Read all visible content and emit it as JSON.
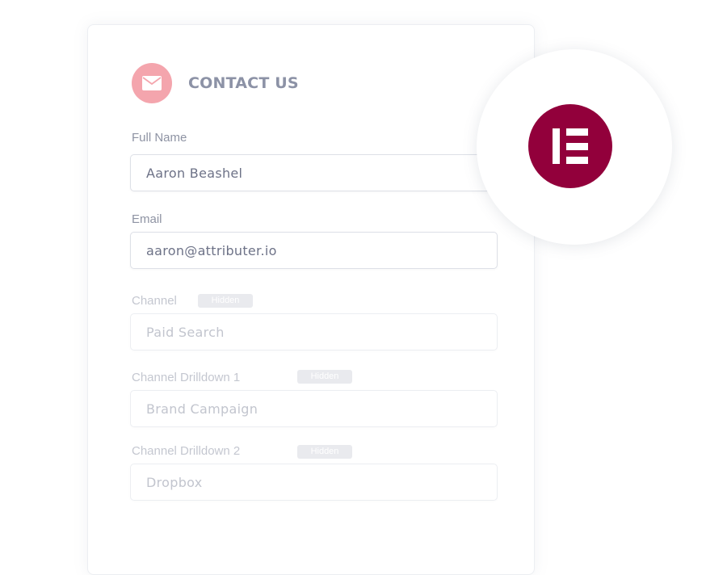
{
  "form": {
    "title": "CONTACT US",
    "header_icon": "envelope-icon",
    "fields": [
      {
        "label": "Full Name",
        "value": "Aaron Beashel",
        "hidden": false
      },
      {
        "label": "Email",
        "value": "aaron@attributer.io",
        "hidden": false
      },
      {
        "label": "Channel",
        "value": "Paid Search",
        "hidden": true,
        "badge": "Hidden"
      },
      {
        "label": "Channel Drilldown 1",
        "value": "Brand Campaign",
        "hidden": true,
        "badge": "Hidden"
      },
      {
        "label": "Channel Drilldown 2",
        "value": "Dropbox",
        "hidden": true,
        "badge": "Hidden"
      }
    ]
  },
  "logo": {
    "icon": "elementor-logo-icon",
    "color": "#92003b"
  },
  "colors": {
    "accent_pink": "#f4a5ad",
    "title_gray": "#8c92a6",
    "badge_bg": "#e9eaee"
  }
}
